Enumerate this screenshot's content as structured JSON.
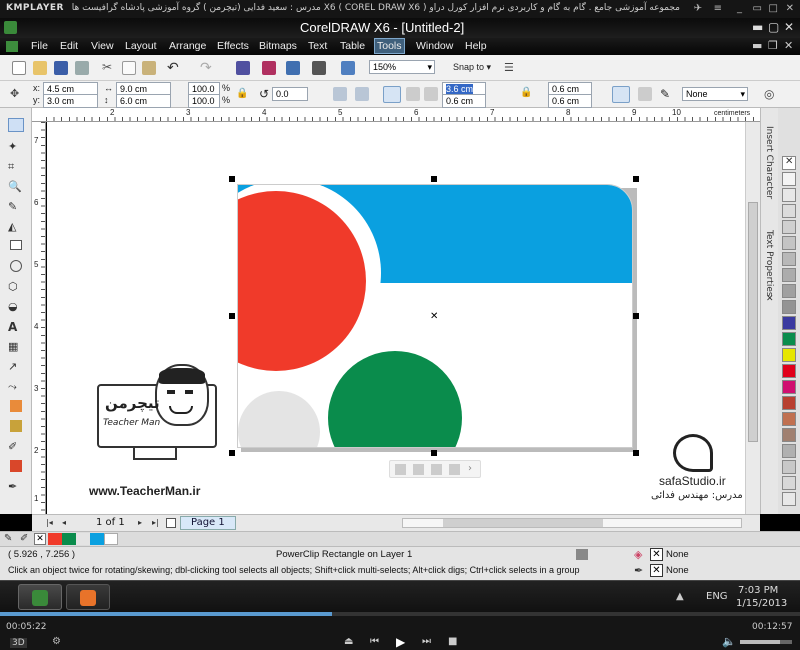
{
  "player": {
    "logo": "KMPLAYER",
    "title": "مجموعه آموزشی جامع . گام به گام و کاربردی نرم افزار کورل دراو X6 ( COREL DRAW X6 ) مدرس : سعید فدایی (تیچرمن ) گروه آموزشی پادشاه گرافیست ها",
    "elapsed": "00:05:22",
    "duration": "00:12:57",
    "progress": 0.415
  },
  "app": {
    "title": "CorelDRAW X6 - [Untitled-2]"
  },
  "menu": {
    "items": [
      "File",
      "Edit",
      "View",
      "Layout",
      "Arrange",
      "Effects",
      "Bitmaps",
      "Text",
      "Table",
      "Tools",
      "Window",
      "Help"
    ],
    "active": "Tools"
  },
  "toolbar": {
    "zoom": "150%",
    "snap": "Snap to"
  },
  "props": {
    "x": "4.5 cm",
    "y": "3.0 cm",
    "w": "9.0 cm",
    "h": "6.0 cm",
    "sx": "100.0",
    "sy": "100.0",
    "pct": "%",
    "angle": "0.0",
    "corner1": "3.6 cm",
    "corner2": "0.6 cm",
    "corner3": "0.6 cm",
    "corner4": "0.6 cm",
    "outline": "None"
  },
  "ruler": {
    "h_ticks": [
      "2",
      "3",
      "4",
      "5",
      "6",
      "7",
      "8",
      "9",
      "10"
    ],
    "units": "centimeters",
    "v_ticks": [
      "7",
      "6",
      "5",
      "4",
      "3",
      "2",
      "1"
    ]
  },
  "dockers": {
    "tab1": "Insert Character",
    "tab2": "Text Properties"
  },
  "page_nav": {
    "count": "1 of 1",
    "page_tab": "Page 1"
  },
  "overlay": {
    "teacher_url": "www.TeacherMan.ir",
    "teacher_name": "Teacher Man",
    "teacher_fa": "تیچرمن",
    "studio": "safaStudio.ir",
    "instructor": "مدرس: مهندس فدائی"
  },
  "status": {
    "coords": "( 5.926 , 7.256 )",
    "object": "PowerClip Rectangle on Layer 1",
    "fill": "None",
    "outline": "None",
    "hint": "Click an object twice for rotating/skewing; dbl-clicking tool selects all objects; Shift+click multi-selects; Alt+click digs; Ctrl+click selects in a group"
  },
  "taskbar": {
    "lang": "ENG",
    "time": "7:03 PM",
    "date": "1/15/2013"
  },
  "colors": {
    "blue": "#0aa0e0",
    "red": "#f03a2a",
    "green": "#0a8c4c",
    "gray": "#e4e4e4"
  }
}
